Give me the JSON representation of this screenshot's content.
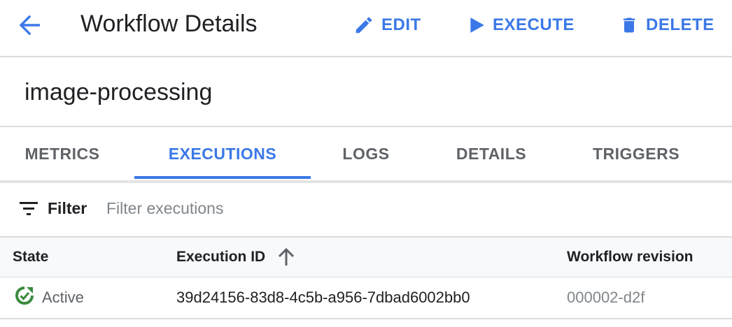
{
  "header": {
    "title": "Workflow Details",
    "back_icon": "arrow-back-icon",
    "actions": [
      {
        "label": "EDIT",
        "icon": "pencil-icon"
      },
      {
        "label": "EXECUTE",
        "icon": "play-icon"
      },
      {
        "label": "DELETE",
        "icon": "trash-icon"
      }
    ]
  },
  "resource_name": "image-processing",
  "tabs": [
    {
      "label": "METRICS",
      "active": false
    },
    {
      "label": "EXECUTIONS",
      "active": true
    },
    {
      "label": "LOGS",
      "active": false
    },
    {
      "label": "DETAILS",
      "active": false
    },
    {
      "label": "TRIGGERS",
      "active": false
    }
  ],
  "filter": {
    "label": "Filter",
    "icon": "filter-list-icon",
    "placeholder": "Filter executions",
    "value": ""
  },
  "table": {
    "columns": [
      "State",
      "Execution ID",
      "Workflow revision"
    ],
    "sort_column": "Execution ID",
    "sort_direction": "ascending",
    "rows": [
      {
        "state": "Active",
        "state_icon": "active-status-icon",
        "execution_id": "39d24156-83d8-4c5b-a956-7dbad6002bb0",
        "revision": "000002-d2f"
      }
    ]
  },
  "colors": {
    "accent": "#3b78e7",
    "status_active": "#3c8a3f",
    "text_primary": "#202124",
    "text_secondary": "#5f6368",
    "divider": "#dadce0"
  }
}
